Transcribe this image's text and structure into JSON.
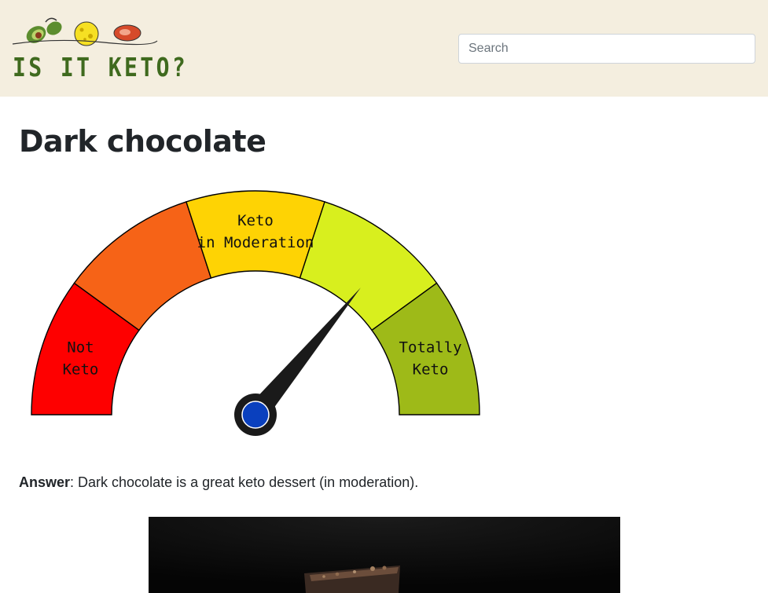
{
  "header": {
    "logo_text": "IS IT KETO?",
    "search_placeholder": "Search"
  },
  "page": {
    "title": "Dark chocolate"
  },
  "gauge": {
    "segments": [
      {
        "label_line1": "Not",
        "label_line2": "Keto",
        "color": "#fe0000"
      },
      {
        "label_line1": "",
        "label_line2": "",
        "color": "#f66317"
      },
      {
        "label_line1": "Keto",
        "label_line2": "in Moderation",
        "color": "#fed304"
      },
      {
        "label_line1": "",
        "label_line2": "",
        "color": "#d8ef1e"
      },
      {
        "label_line1": "Totally",
        "label_line2": "Keto",
        "color": "#9eba18"
      }
    ],
    "needle_color": "#1a1a1a",
    "hub_color": "#0a40be",
    "level": 0.72
  },
  "answer": {
    "label": "Answer",
    "text": ": Dark chocolate is a great keto dessert (in moderation)."
  },
  "image": {
    "icon": "dark-chocolate-photo"
  }
}
